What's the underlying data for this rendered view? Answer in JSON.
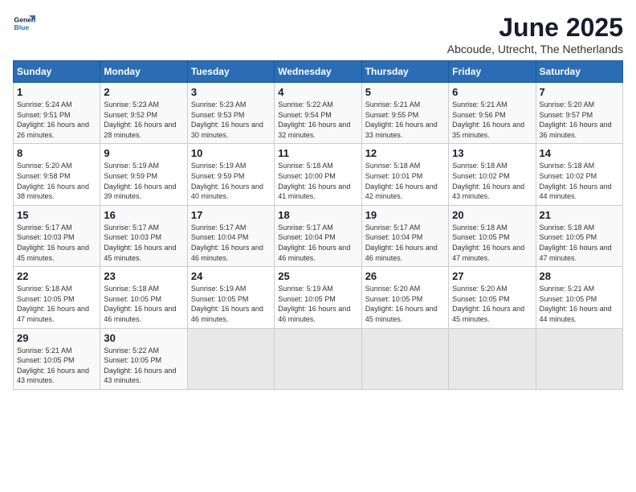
{
  "header": {
    "logo": {
      "general": "General",
      "blue": "Blue"
    },
    "title": "June 2025",
    "subtitle": "Abcoude, Utrecht, The Netherlands"
  },
  "calendar": {
    "days_of_week": [
      "Sunday",
      "Monday",
      "Tuesday",
      "Wednesday",
      "Thursday",
      "Friday",
      "Saturday"
    ],
    "weeks": [
      [
        null,
        {
          "day": "2",
          "sunrise": "5:23 AM",
          "sunset": "9:52 PM",
          "daylight": "16 hours and 28 minutes."
        },
        {
          "day": "3",
          "sunrise": "5:23 AM",
          "sunset": "9:53 PM",
          "daylight": "16 hours and 30 minutes."
        },
        {
          "day": "4",
          "sunrise": "5:22 AM",
          "sunset": "9:54 PM",
          "daylight": "16 hours and 32 minutes."
        },
        {
          "day": "5",
          "sunrise": "5:21 AM",
          "sunset": "9:55 PM",
          "daylight": "16 hours and 33 minutes."
        },
        {
          "day": "6",
          "sunrise": "5:21 AM",
          "sunset": "9:56 PM",
          "daylight": "16 hours and 35 minutes."
        },
        {
          "day": "7",
          "sunrise": "5:20 AM",
          "sunset": "9:57 PM",
          "daylight": "16 hours and 36 minutes."
        }
      ],
      [
        {
          "day": "1",
          "sunrise": "5:24 AM",
          "sunset": "9:51 PM",
          "daylight": "16 hours and 26 minutes."
        },
        null,
        null,
        null,
        null,
        null,
        null
      ],
      [
        {
          "day": "8",
          "sunrise": "5:20 AM",
          "sunset": "9:58 PM",
          "daylight": "16 hours and 38 minutes."
        },
        {
          "day": "9",
          "sunrise": "5:19 AM",
          "sunset": "9:59 PM",
          "daylight": "16 hours and 39 minutes."
        },
        {
          "day": "10",
          "sunrise": "5:19 AM",
          "sunset": "9:59 PM",
          "daylight": "16 hours and 40 minutes."
        },
        {
          "day": "11",
          "sunrise": "5:18 AM",
          "sunset": "10:00 PM",
          "daylight": "16 hours and 41 minutes."
        },
        {
          "day": "12",
          "sunrise": "5:18 AM",
          "sunset": "10:01 PM",
          "daylight": "16 hours and 42 minutes."
        },
        {
          "day": "13",
          "sunrise": "5:18 AM",
          "sunset": "10:02 PM",
          "daylight": "16 hours and 43 minutes."
        },
        {
          "day": "14",
          "sunrise": "5:18 AM",
          "sunset": "10:02 PM",
          "daylight": "16 hours and 44 minutes."
        }
      ],
      [
        {
          "day": "15",
          "sunrise": "5:17 AM",
          "sunset": "10:03 PM",
          "daylight": "16 hours and 45 minutes."
        },
        {
          "day": "16",
          "sunrise": "5:17 AM",
          "sunset": "10:03 PM",
          "daylight": "16 hours and 45 minutes."
        },
        {
          "day": "17",
          "sunrise": "5:17 AM",
          "sunset": "10:04 PM",
          "daylight": "16 hours and 46 minutes."
        },
        {
          "day": "18",
          "sunrise": "5:17 AM",
          "sunset": "10:04 PM",
          "daylight": "16 hours and 46 minutes."
        },
        {
          "day": "19",
          "sunrise": "5:17 AM",
          "sunset": "10:04 PM",
          "daylight": "16 hours and 46 minutes."
        },
        {
          "day": "20",
          "sunrise": "5:18 AM",
          "sunset": "10:05 PM",
          "daylight": "16 hours and 47 minutes."
        },
        {
          "day": "21",
          "sunrise": "5:18 AM",
          "sunset": "10:05 PM",
          "daylight": "16 hours and 47 minutes."
        }
      ],
      [
        {
          "day": "22",
          "sunrise": "5:18 AM",
          "sunset": "10:05 PM",
          "daylight": "16 hours and 47 minutes."
        },
        {
          "day": "23",
          "sunrise": "5:18 AM",
          "sunset": "10:05 PM",
          "daylight": "16 hours and 46 minutes."
        },
        {
          "day": "24",
          "sunrise": "5:19 AM",
          "sunset": "10:05 PM",
          "daylight": "16 hours and 46 minutes."
        },
        {
          "day": "25",
          "sunrise": "5:19 AM",
          "sunset": "10:05 PM",
          "daylight": "16 hours and 46 minutes."
        },
        {
          "day": "26",
          "sunrise": "5:20 AM",
          "sunset": "10:05 PM",
          "daylight": "16 hours and 45 minutes."
        },
        {
          "day": "27",
          "sunrise": "5:20 AM",
          "sunset": "10:05 PM",
          "daylight": "16 hours and 45 minutes."
        },
        {
          "day": "28",
          "sunrise": "5:21 AM",
          "sunset": "10:05 PM",
          "daylight": "16 hours and 44 minutes."
        }
      ],
      [
        {
          "day": "29",
          "sunrise": "5:21 AM",
          "sunset": "10:05 PM",
          "daylight": "16 hours and 43 minutes."
        },
        {
          "day": "30",
          "sunrise": "5:22 AM",
          "sunset": "10:05 PM",
          "daylight": "16 hours and 43 minutes."
        },
        null,
        null,
        null,
        null,
        null
      ]
    ]
  }
}
